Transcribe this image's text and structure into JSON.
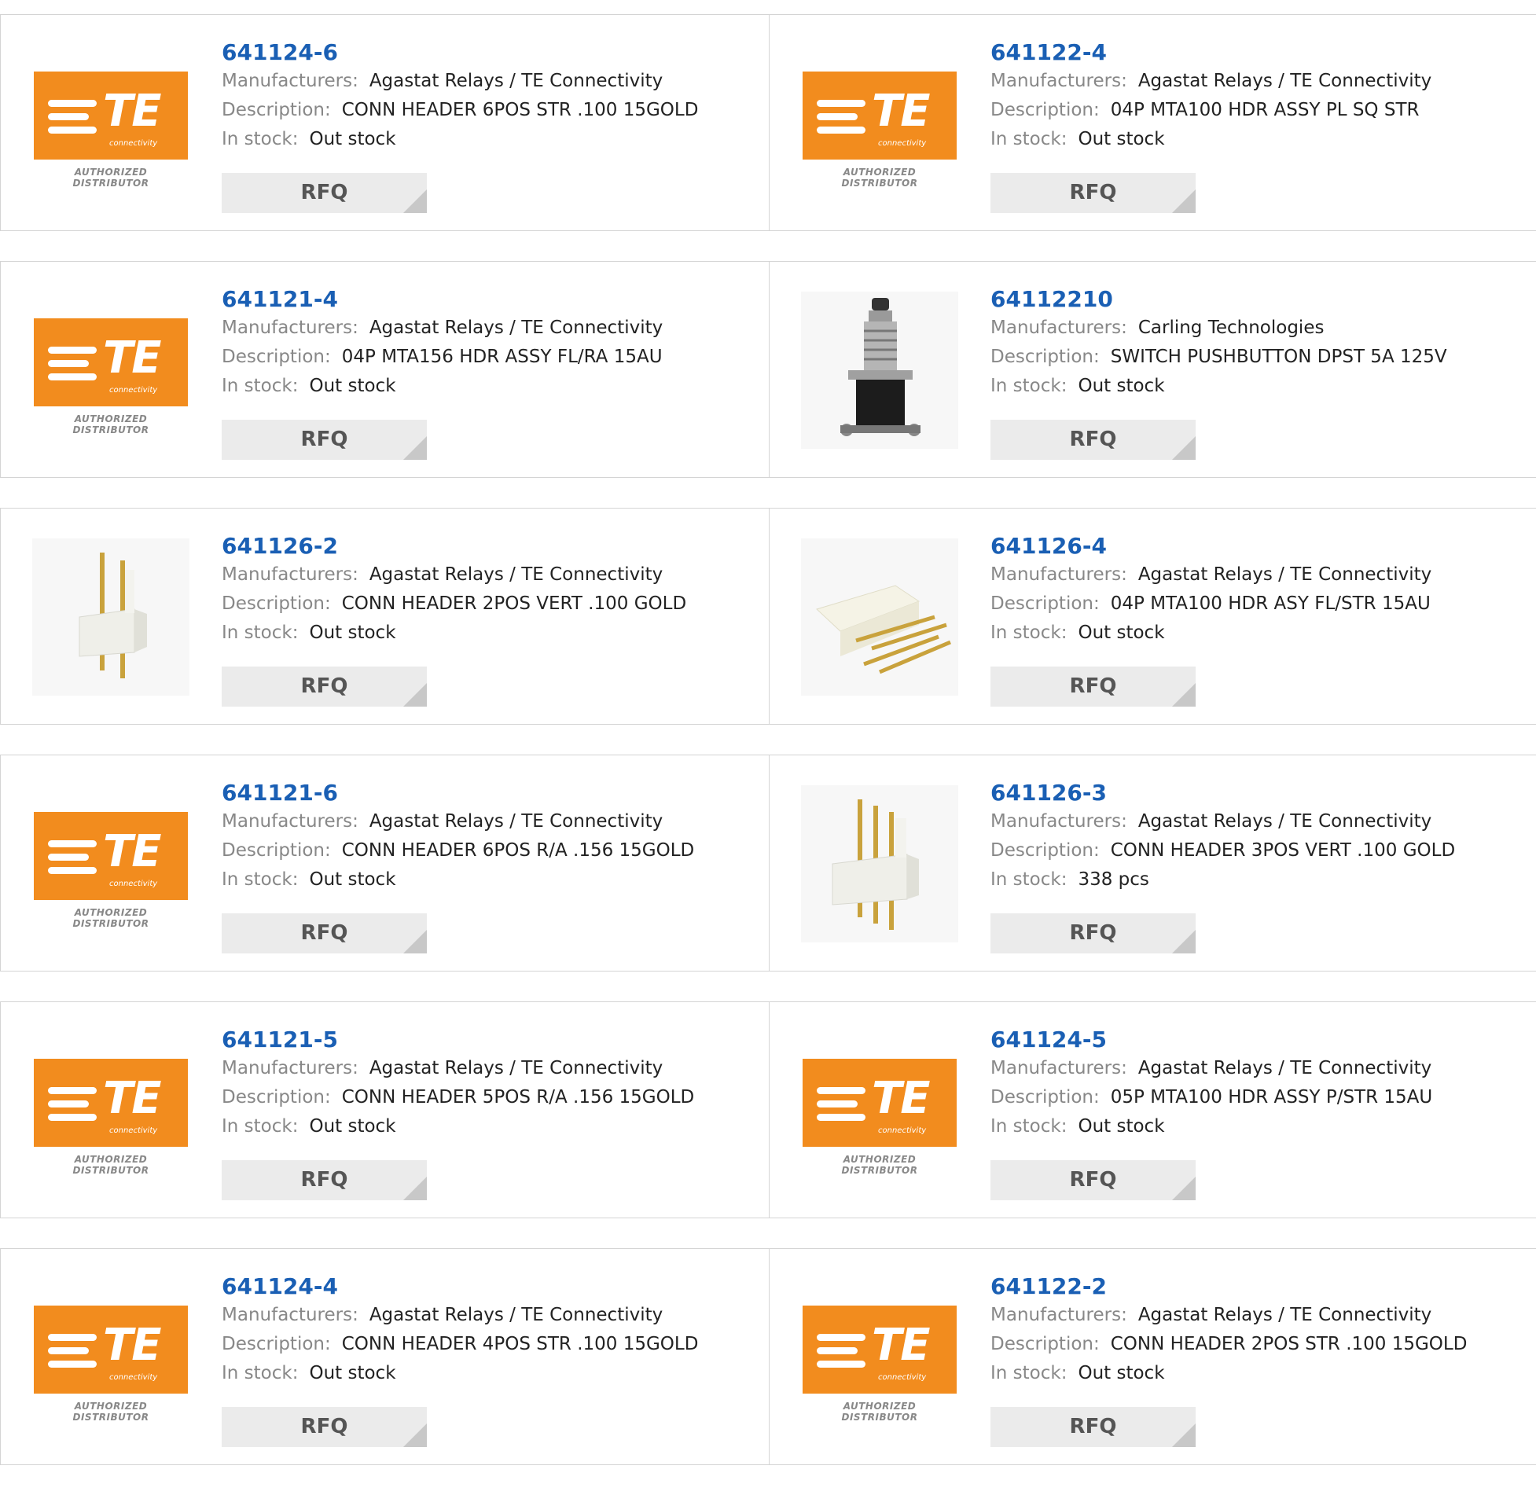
{
  "labels": {
    "manufacturers": "Manufacturers:",
    "description": "Description:",
    "stock": "In stock:",
    "rfq": "RFQ"
  },
  "logo": {
    "wordmark": "TE",
    "sub": "connectivity",
    "authorized": "AUTHORIZED DISTRIBUTOR",
    "brand_color": "#f28c1e"
  },
  "products": [
    {
      "pn": "641124-6",
      "mfr": "Agastat Relays / TE Connectivity",
      "desc": "CONN HEADER 6POS STR .100 15GOLD",
      "stock": "Out stock",
      "image": "te-logo"
    },
    {
      "pn": "641122-4",
      "mfr": "Agastat Relays / TE Connectivity",
      "desc": "04P MTA100 HDR ASSY PL SQ STR",
      "stock": "Out stock",
      "image": "te-logo"
    },
    {
      "pn": "641121-4",
      "mfr": "Agastat Relays / TE Connectivity",
      "desc": "04P MTA156 HDR ASSY FL/RA 15AU",
      "stock": "Out stock",
      "image": "te-logo"
    },
    {
      "pn": "64112210",
      "mfr": "Carling Technologies",
      "desc": "SWITCH PUSHBUTTON DPST 5A 125V",
      "stock": "Out stock",
      "image": "pushbutton-switch"
    },
    {
      "pn": "641126-2",
      "mfr": "Agastat Relays / TE Connectivity",
      "desc": "CONN HEADER 2POS VERT .100 GOLD",
      "stock": "Out stock",
      "image": "header-vertical-2pin"
    },
    {
      "pn": "641126-4",
      "mfr": "Agastat Relays / TE Connectivity",
      "desc": "04P MTA100 HDR ASY FL/STR 15AU",
      "stock": "Out stock",
      "image": "header-right-angle-4pin"
    },
    {
      "pn": "641121-6",
      "mfr": "Agastat Relays / TE Connectivity",
      "desc": "CONN HEADER 6POS R/A .156 15GOLD",
      "stock": "Out stock",
      "image": "te-logo"
    },
    {
      "pn": "641126-3",
      "mfr": "Agastat Relays / TE Connectivity",
      "desc": "CONN HEADER 3POS VERT .100 GOLD",
      "stock": "338 pcs",
      "image": "header-vertical-3pin"
    },
    {
      "pn": "641121-5",
      "mfr": "Agastat Relays / TE Connectivity",
      "desc": "CONN HEADER 5POS R/A .156 15GOLD",
      "stock": "Out stock",
      "image": "te-logo"
    },
    {
      "pn": "641124-5",
      "mfr": "Agastat Relays / TE Connectivity",
      "desc": "05P MTA100 HDR ASSY P/STR 15AU",
      "stock": "Out stock",
      "image": "te-logo"
    },
    {
      "pn": "641124-4",
      "mfr": "Agastat Relays / TE Connectivity",
      "desc": "CONN HEADER 4POS STR .100 15GOLD",
      "stock": "Out stock",
      "image": "te-logo"
    },
    {
      "pn": "641122-2",
      "mfr": "Agastat Relays / TE Connectivity",
      "desc": "CONN HEADER 2POS STR .100 15GOLD",
      "stock": "Out stock",
      "image": "te-logo"
    }
  ]
}
